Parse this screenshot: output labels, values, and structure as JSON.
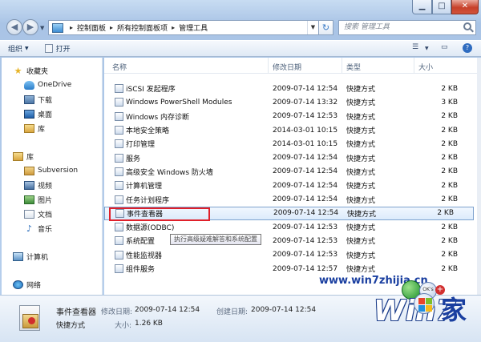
{
  "window": {
    "controls": {
      "minimize": "▁",
      "maximize": "□",
      "close": "✕"
    }
  },
  "address_bar": {
    "back": "◀",
    "forward": "▶",
    "path": [
      "控制面板",
      "所有控制面板项",
      "管理工具"
    ],
    "refresh": "↻"
  },
  "search": {
    "placeholder": "搜索 管理工具"
  },
  "toolbar": {
    "organize": "组织",
    "open": "打开",
    "view": "☰",
    "help": "?"
  },
  "navigation": {
    "favorites": "收藏夹",
    "items": [
      {
        "label": "收藏夹",
        "icon": "star-icon"
      },
      {
        "label": "OneDrive",
        "icon": "cloud-icon"
      },
      {
        "label": "下载",
        "icon": "download-folder-icon"
      },
      {
        "label": "桌面",
        "icon": "desktop-icon"
      },
      {
        "label": "库",
        "icon": "library-icon"
      },
      {
        "label": "库",
        "icon": "library-icon"
      },
      {
        "label": "Subversion",
        "icon": "folder-icon"
      },
      {
        "label": "视频",
        "icon": "video-icon"
      },
      {
        "label": "图片",
        "icon": "picture-icon"
      },
      {
        "label": "文档",
        "icon": "document-icon"
      },
      {
        "label": "音乐",
        "icon": "music-icon"
      },
      {
        "label": "计算机",
        "icon": "computer-icon"
      },
      {
        "label": "网络",
        "icon": "network-icon"
      }
    ]
  },
  "columns": {
    "name": "名称",
    "date": "修改日期",
    "type": "类型",
    "size": "大小"
  },
  "files": [
    {
      "name": "iSCSI 发起程序",
      "date": "2009-07-14 12:54",
      "type": "快捷方式",
      "size": "2 KB"
    },
    {
      "name": "Windows PowerShell Modules",
      "date": "2009-07-14 13:32",
      "type": "快捷方式",
      "size": "3 KB"
    },
    {
      "name": "Windows 内存诊断",
      "date": "2009-07-14 12:53",
      "type": "快捷方式",
      "size": "2 KB"
    },
    {
      "name": "本地安全策略",
      "date": "2014-03-01 10:15",
      "type": "快捷方式",
      "size": "2 KB"
    },
    {
      "name": "打印管理",
      "date": "2014-03-01 10:15",
      "type": "快捷方式",
      "size": "2 KB"
    },
    {
      "name": "服务",
      "date": "2009-07-14 12:54",
      "type": "快捷方式",
      "size": "2 KB"
    },
    {
      "name": "高级安全 Windows 防火墙",
      "date": "2009-07-14 12:54",
      "type": "快捷方式",
      "size": "2 KB"
    },
    {
      "name": "计算机管理",
      "date": "2009-07-14 12:54",
      "type": "快捷方式",
      "size": "2 KB"
    },
    {
      "name": "任务计划程序",
      "date": "2009-07-14 12:54",
      "type": "快捷方式",
      "size": "2 KB"
    },
    {
      "name": "事件查看器",
      "date": "2009-07-14 12:54",
      "type": "快捷方式",
      "size": "2 KB"
    },
    {
      "name": "数据源(ODBC)",
      "date": "2009-07-14 12:53",
      "type": "快捷方式",
      "size": "2 KB"
    },
    {
      "name": "系统配置",
      "date": "2009-07-14 12:53",
      "type": "快捷方式",
      "size": "2 KB"
    },
    {
      "name": "性能监视器",
      "date": "2009-07-14 12:53",
      "type": "快捷方式",
      "size": "2 KB"
    },
    {
      "name": "组件服务",
      "date": "2009-07-14 12:57",
      "type": "快捷方式",
      "size": "2 KB"
    }
  ],
  "selected_index": 9,
  "tooltip": "执行高级疑难解答和系统配置",
  "details": {
    "name": "事件查看器",
    "type": "快捷方式",
    "modified_label": "修改日期:",
    "modified_value": "2009-07-14 12:54",
    "size_label": "大小:",
    "size_value": "1.26 KB",
    "created_label": "创建日期:",
    "created_value": "2009-07-14 12:54"
  },
  "watermark": {
    "site": "www.win7zhijia.cn",
    "logo_text": "Win7",
    "logo_suffix": "家",
    "badge": "OK's"
  },
  "colors": {
    "selection_outline": "#e0202a",
    "selection_bg": "#dcebfc",
    "window_chrome": "#b9d1ee",
    "close_button": "#c7402a"
  }
}
